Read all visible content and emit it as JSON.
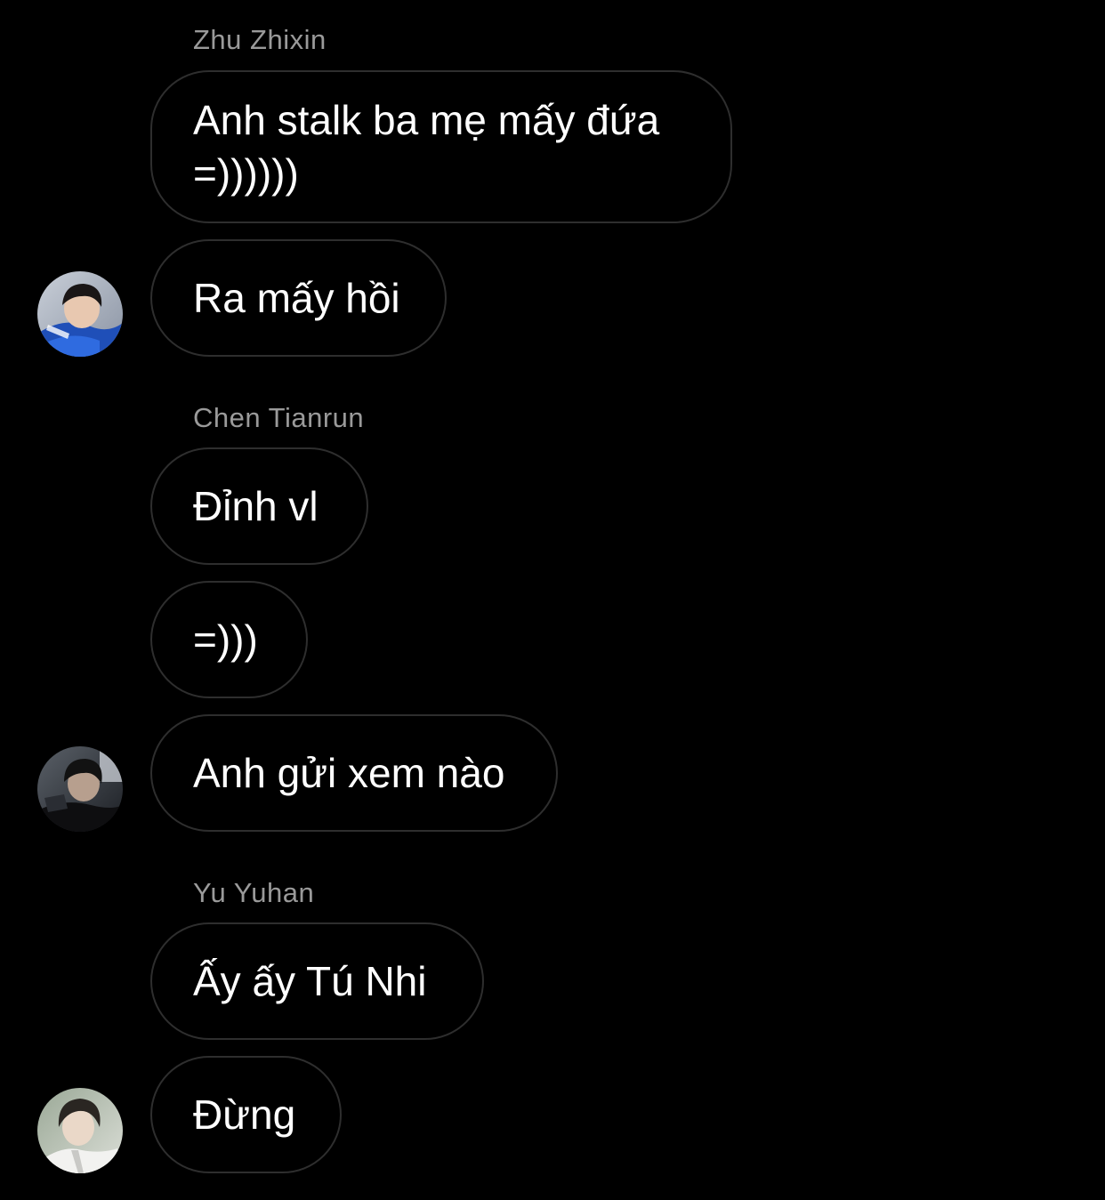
{
  "messages": {
    "group1": {
      "sender": "Zhu Zhixin",
      "bubbles": [
        "Anh stalk ba mẹ mấy đứa\n=))))))",
        "Ra mấy hồi"
      ]
    },
    "group2": {
      "sender": "Chen Tianrun",
      "bubbles": [
        "Đỉnh vl",
        "=)))",
        "Anh gửi xem nào"
      ]
    },
    "group3": {
      "sender": "Yu Yuhan",
      "bubbles": [
        "Ấy ấy Tú Nhi",
        "Đừng"
      ]
    }
  },
  "colors": {
    "background": "#000000",
    "bubble_border": "#2e2e2e",
    "sender_name": "#9a9a9a",
    "text": "#ffffff"
  }
}
